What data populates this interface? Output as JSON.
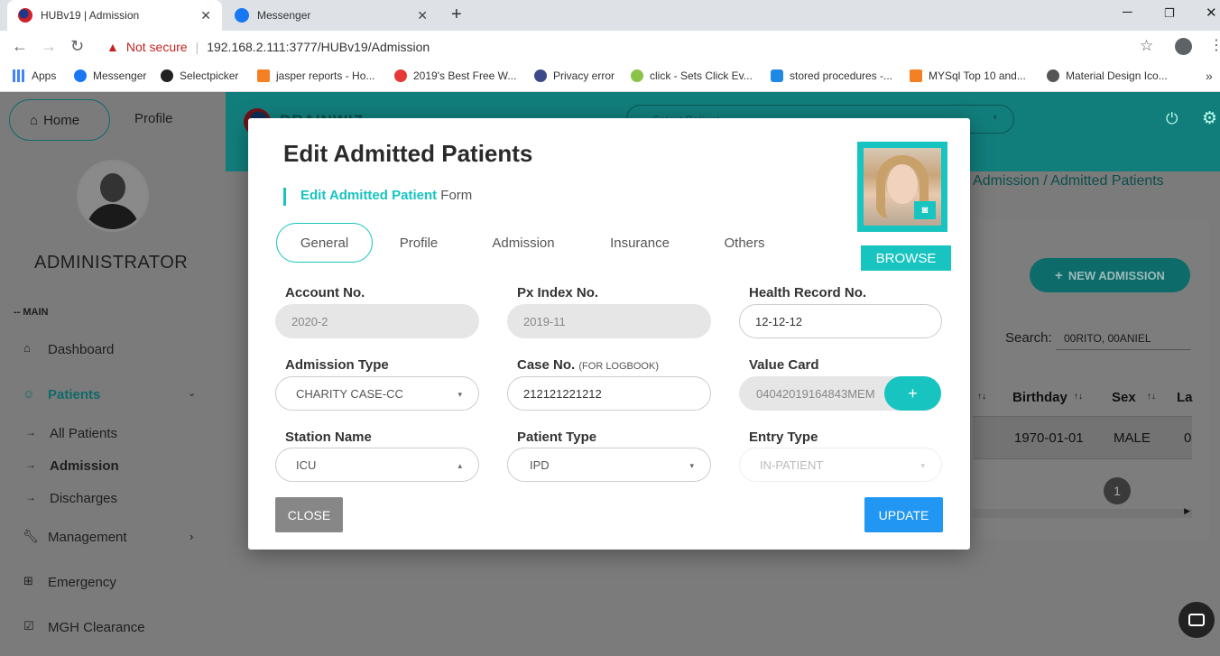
{
  "browser": {
    "tabs": [
      {
        "title": "HUBv19 | Admission",
        "active": true
      },
      {
        "title": "Messenger",
        "active": false
      }
    ],
    "url_warning": "Not secure",
    "url": "192.168.2.111:3777/HUBv19/Admission",
    "bookmarks": [
      "Apps",
      "Messenger",
      "Selectpicker",
      "jasper reports - Ho...",
      "2019's Best Free W...",
      "Privacy error",
      "click - Sets Click Ev...",
      "stored procedures -...",
      "MYSql Top 10 and...",
      "Material Design Ico..."
    ]
  },
  "sidebar": {
    "home": "Home",
    "profile": "Profile",
    "username": "ADMINISTRATOR",
    "section": "-- MAIN",
    "items": {
      "dashboard": "Dashboard",
      "patients": "Patients",
      "all_patients": "All Patients",
      "admission": "Admission",
      "discharges": "Discharges",
      "management": "Management",
      "emergency": "Emergency",
      "mgh": "MGH Clearance"
    }
  },
  "topbar": {
    "logo": "DRAINWIZ",
    "search_placeholder": "Select Patient"
  },
  "main": {
    "breadcrumb": [
      "Admission",
      "Admitted Patients"
    ],
    "new_admission": "NEW ADMISSION",
    "search_label": "Search:",
    "search_value": "00RITO, 00ANIEL",
    "table": {
      "headers": [
        "Birthday",
        "Sex",
        "La"
      ],
      "row": [
        "1970-01-01",
        "MALE",
        "0"
      ]
    },
    "page": "1"
  },
  "modal": {
    "title": "Edit Admitted Patients",
    "subtitle_bold": "Edit Admitted Patient",
    "subtitle_rest": "Form",
    "browse": "BROWSE",
    "tabs": [
      "General",
      "Profile",
      "Admission",
      "Insurance",
      "Others"
    ],
    "fields": {
      "account_no": {
        "label": "Account No.",
        "value": "2020-2"
      },
      "px_index": {
        "label": "Px Index No.",
        "value": "2019-11"
      },
      "health_record": {
        "label": "Health Record No.",
        "value": "12-12-12"
      },
      "admission_type": {
        "label": "Admission Type",
        "value": "CHARITY CASE-CC"
      },
      "case_no": {
        "label": "Case No.",
        "sublabel": "(FOR LOGBOOK)",
        "value": "212121221212"
      },
      "value_card": {
        "label": "Value Card",
        "value": "04042019164843MEM"
      },
      "station_name": {
        "label": "Station Name",
        "value": "ICU"
      },
      "patient_type": {
        "label": "Patient Type",
        "value": "IPD"
      },
      "entry_type": {
        "label": "Entry Type",
        "value": "IN-PATIENT"
      }
    },
    "close": "CLOSE",
    "update": "UPDATE"
  },
  "colors": {
    "teal": "#17c4c0",
    "blue": "#2196f3",
    "gray_btn": "#878787"
  }
}
